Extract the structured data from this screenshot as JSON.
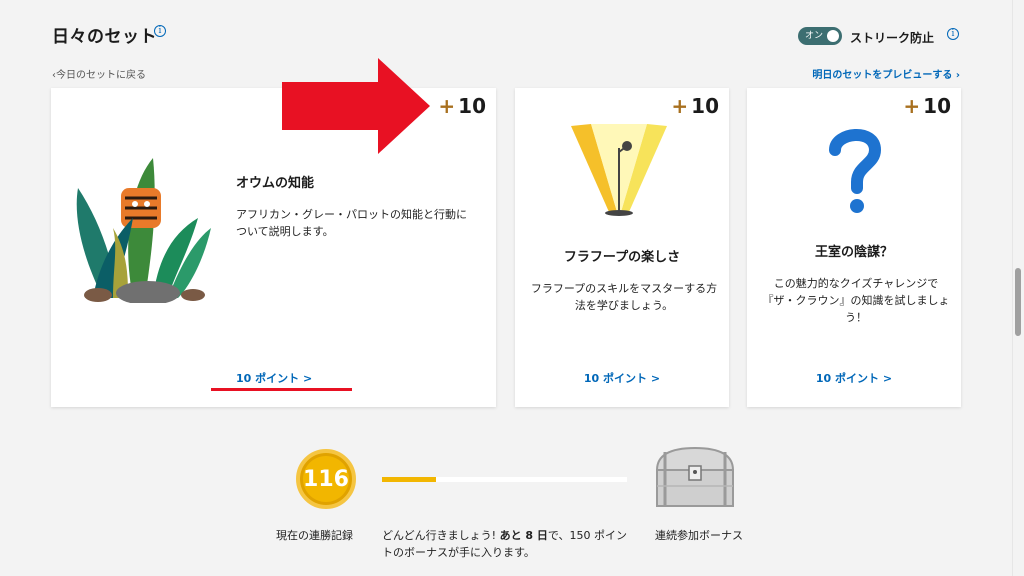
{
  "header": {
    "title": "日々のセット",
    "back_link": "今日のセットに戻る",
    "preview_link": "明日のセットをプレビューする",
    "toggle_state": "オン",
    "toggle_label": "ストリーク防止"
  },
  "cards": [
    {
      "points_plus": "+",
      "points": "10",
      "title": "オウムの知能",
      "description": "アフリカン・グレー・パロットの知能と行動について説明します。",
      "link": "10 ポイント >"
    },
    {
      "points_plus": "+",
      "points": "10",
      "title": "フラフープの楽しさ",
      "description": "フラフープのスキルをマスターする方法を学びましょう。",
      "link": "10 ポイント >"
    },
    {
      "points_plus": "+",
      "points": "10",
      "title": "王室の陰謀？",
      "description": "この魅力的なクイズチャレンジで『ザ・クラウン』の知識を試しましょう！",
      "link": "10 ポイント >"
    }
  ],
  "streak": {
    "count": "116",
    "label": "現在の連勝記録",
    "progress_fraction": 0.22,
    "message_prefix": "どんどん行きましょう! ",
    "message_bold": "あと 8 日",
    "message_suffix": "で、150 ポイントのボーナスが手に入ります。",
    "bonus_label": "連続参加ボーナス"
  },
  "colors": {
    "accent_link": "#0067b8",
    "points_plus": "#a8701f",
    "annotation_red": "#e81123",
    "streak_gold": "#f2b600"
  },
  "icons": [
    "info-icon",
    "chevron-left-icon",
    "chevron-right-icon",
    "question-mark-icon",
    "treasure-chest-icon"
  ]
}
